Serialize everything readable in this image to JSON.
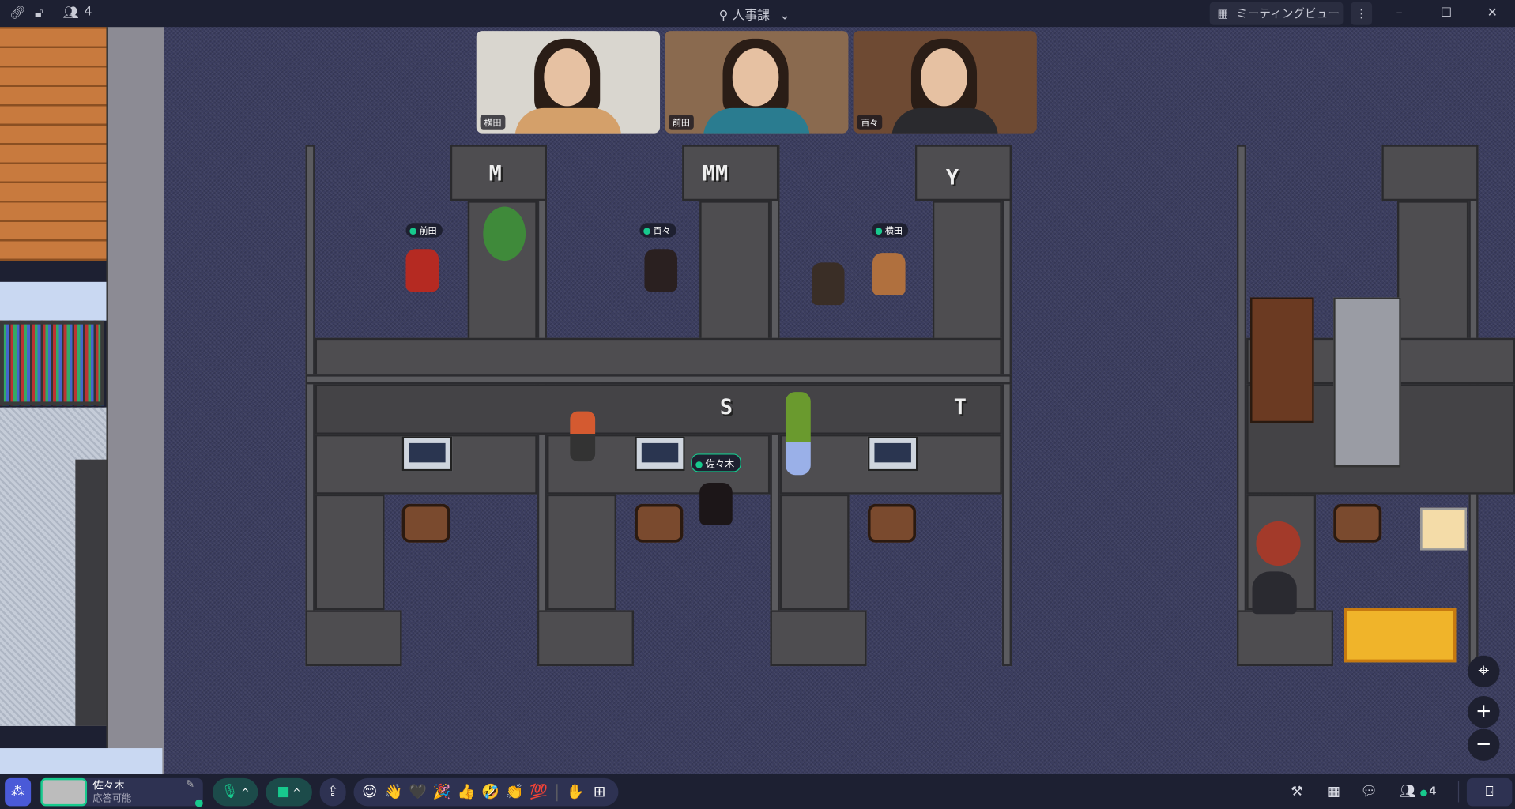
{
  "topbar": {
    "participant_count": "4",
    "room_name": "人事課",
    "meeting_view_label": "ミーティングビュー",
    "minimize": "–",
    "maximize": "☐",
    "close": "✕"
  },
  "videos": [
    {
      "name": "横田"
    },
    {
      "name": "前田"
    },
    {
      "name": "百々"
    }
  ],
  "map": {
    "desk_signs": [
      "M",
      "MM",
      "Y",
      "S",
      "T"
    ],
    "avatars": [
      {
        "name": "前田"
      },
      {
        "name": "百々"
      },
      {
        "name": "横田"
      },
      {
        "name": "佐々木"
      }
    ],
    "controls": {
      "locate": "⌖",
      "zoom_in": "+",
      "zoom_out": "−"
    }
  },
  "bottombar": {
    "user_name": "佐々木",
    "user_status": "応答可能",
    "status_color": "#17c98d",
    "emoji": [
      "😊",
      "👋",
      "🖤",
      "🎉",
      "👍",
      "🤣",
      "👏",
      "💯"
    ],
    "raise_hand": "✋",
    "more_reactions": "⊞",
    "participant_count": "4"
  }
}
